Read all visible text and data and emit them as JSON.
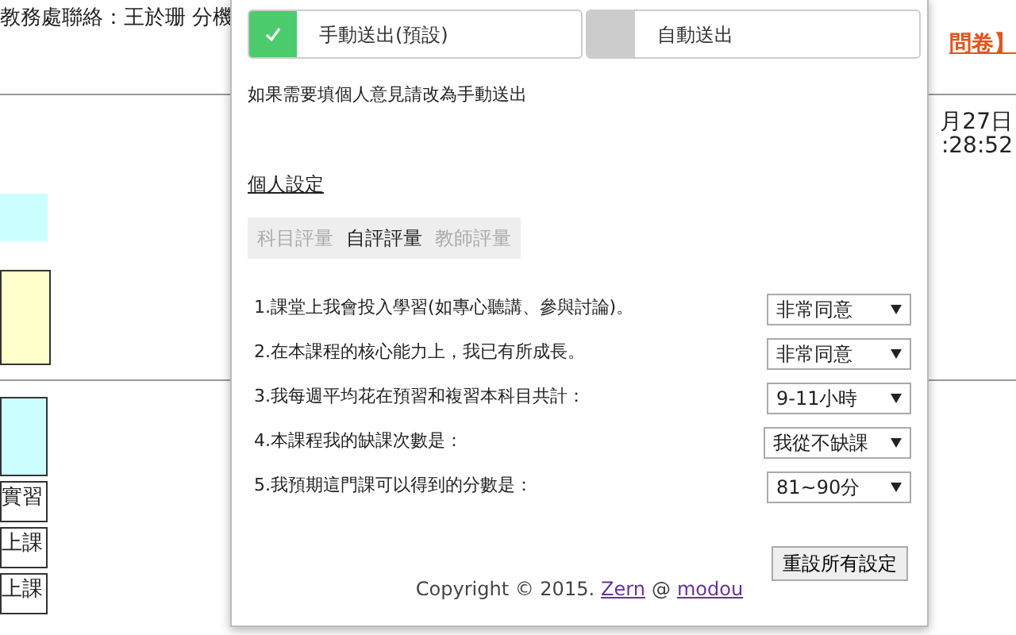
{
  "background_page": {
    "contact": "教務處聯絡：王於珊 分機",
    "link": "問卷】",
    "date": "月27日",
    "time": ":28:52",
    "cells": [
      "實習",
      "上課",
      "上課"
    ]
  },
  "popup": {
    "send_modes": [
      {
        "label": "手動送出(預設)",
        "selected": true
      },
      {
        "label": "自動送出",
        "selected": false
      }
    ],
    "note": "如果需要填個人意見請改為手動送出",
    "section_title": "個人設定",
    "tabs": [
      {
        "label": "科目評量",
        "selected": false
      },
      {
        "label": "自評評量",
        "selected": true
      },
      {
        "label": "教師評量",
        "selected": false
      }
    ],
    "questions": [
      {
        "text": "1.課堂上我會投入學習(如專心聽講、參與討論)。",
        "value": "非常同意"
      },
      {
        "text": "2.在本課程的核心能力上，我已有所成長。",
        "value": "非常同意"
      },
      {
        "text": "3.我每週平均花在預習和複習本科目共計：",
        "value": "9-11小時"
      },
      {
        "text": "4.本課程我的缺課次數是：",
        "value": "我從不缺課"
      },
      {
        "text": "5.我預期這門課可以得到的分數是：",
        "value": "81~90分"
      }
    ],
    "reset_button": "重設所有設定",
    "copyright": {
      "text": "Copyright © 2015.",
      "author": "Zern",
      "at": "@",
      "site": "modou"
    }
  }
}
